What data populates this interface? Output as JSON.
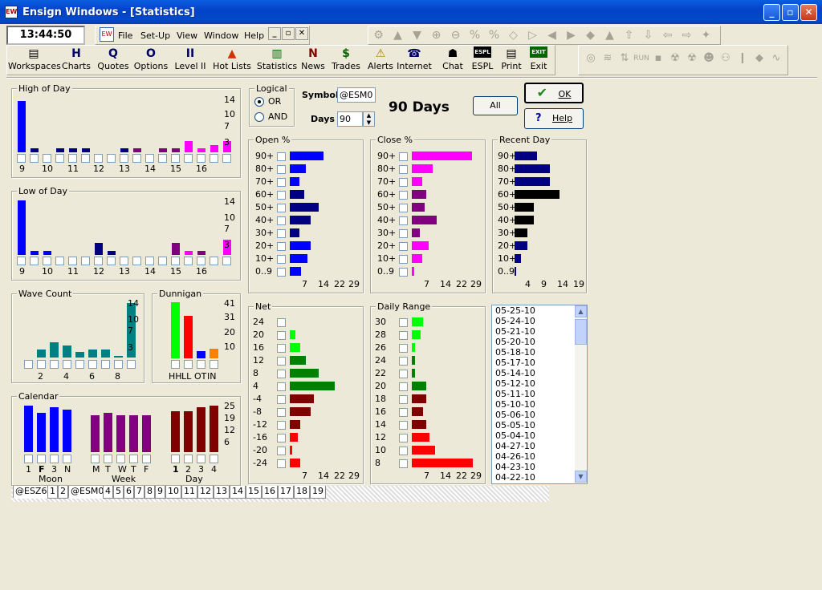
{
  "window": {
    "title": "Ensign Windows - [Statistics]",
    "minimize": "_",
    "maximize": "▫",
    "close": "✕"
  },
  "clock": "13:44:50",
  "menu": [
    "File",
    "Set-Up",
    "View",
    "Window",
    "Help"
  ],
  "toolbar": [
    "Workspaces",
    "Charts",
    "Quotes",
    "Options",
    "Level II",
    "Hot Lists",
    "Statistics",
    "News",
    "Trades",
    "Alerts",
    "Internet",
    "Chat",
    "ESPL",
    "Print",
    "Exit"
  ],
  "toolbar_glyphs": [
    "▤",
    "H",
    "Q",
    "O",
    "II",
    "▲",
    "▥",
    "N",
    "$",
    "⚠",
    "☎",
    "☗",
    "ESPL",
    "▤",
    "EXIT"
  ],
  "logical": {
    "title": "Logical",
    "or": "OR",
    "and": "AND"
  },
  "symbol": {
    "label": "Symbol",
    "value": "@ESM0"
  },
  "days": {
    "label": "Days",
    "value": "90",
    "heading": "90 Days"
  },
  "buttons": {
    "all": "All",
    "ok": "OK",
    "help": "Help"
  },
  "colors": {
    "blue": "#0000ff",
    "navy": "#000080",
    "magenta": "#ff00ff",
    "purple": "#800080",
    "teal": "#008080",
    "green": "#00ff00",
    "dkgreen": "#008000",
    "dkred": "#800000",
    "red": "#ff0000",
    "black": "#000000",
    "orange": "#ff8000"
  },
  "high_of_day": {
    "title": "High of Day",
    "y_ticks": [
      "14",
      "10",
      "7",
      "3"
    ],
    "x_labels": [
      "9",
      "10",
      "11",
      "12",
      "13",
      "14",
      "15",
      "16"
    ],
    "values": [
      14,
      1,
      0,
      1,
      1,
      1,
      0,
      0,
      1,
      1,
      0,
      1,
      1,
      3,
      1,
      2,
      3
    ],
    "colors": [
      "blue",
      "navy",
      "navy",
      "navy",
      "navy",
      "navy",
      "navy",
      "navy",
      "navy",
      "purple",
      "purple",
      "purple",
      "purple",
      "magenta",
      "magenta",
      "magenta",
      "magenta"
    ]
  },
  "low_of_day": {
    "title": "Low of Day",
    "y_ticks": [
      "14",
      "10",
      "7",
      "3"
    ],
    "x_labels": [
      "9",
      "10",
      "11",
      "12",
      "13",
      "14",
      "15",
      "16"
    ],
    "values": [
      14,
      1,
      1,
      0,
      0,
      0,
      3,
      1,
      0,
      0,
      0,
      0,
      3,
      1,
      1,
      0,
      4
    ],
    "colors": [
      "blue",
      "blue",
      "blue",
      "navy",
      "navy",
      "navy",
      "navy",
      "navy",
      "navy",
      "navy",
      "purple",
      "purple",
      "purple",
      "magenta",
      "purple",
      "magenta",
      "magenta"
    ]
  },
  "wave_count": {
    "title": "Wave Count",
    "y_ticks": [
      "14",
      "10",
      "7",
      "3"
    ],
    "x_labels": [
      "2",
      "4",
      "6",
      "8"
    ],
    "values": [
      0,
      2,
      4,
      3,
      1.5,
      2,
      2,
      0.5,
      14
    ]
  },
  "dunnigan": {
    "title": "Dunnigan",
    "y_ticks": [
      "41",
      "31",
      "20",
      "10"
    ],
    "x_labels": [
      "HH",
      "LL",
      "OT",
      "IN"
    ],
    "values": [
      41,
      31,
      5,
      7
    ],
    "colors": [
      "green",
      "red",
      "blue",
      "orange"
    ]
  },
  "calendar": {
    "title": "Calendar",
    "y_ticks": [
      "25",
      "19",
      "12",
      "6"
    ],
    "groups": [
      {
        "label": "Moon",
        "x": [
          "1",
          "F",
          "3",
          "N"
        ],
        "values": [
          25,
          21,
          24,
          23
        ]
      },
      {
        "label": "Week",
        "x": [
          "M",
          "T",
          "W",
          "T",
          "F"
        ],
        "values": [
          20,
          21,
          20,
          20,
          20
        ]
      },
      {
        "label": "Day",
        "x": [
          "1",
          "2",
          "3",
          "4"
        ],
        "values": [
          22,
          22,
          24,
          25
        ]
      }
    ]
  },
  "open_pct": {
    "title": "Open  %",
    "rows": [
      "90+",
      "80+",
      "70+",
      "60+",
      "50+",
      "40+",
      "30+",
      "20+",
      "10+",
      "0..9"
    ],
    "values": [
      21,
      10,
      6,
      9,
      18,
      13,
      6,
      13,
      11,
      7
    ],
    "colors": [
      "blue",
      "blue",
      "blue",
      "navy",
      "navy",
      "navy",
      "navy",
      "blue",
      "blue",
      "blue"
    ],
    "x_ticks": [
      "7",
      "14",
      "22",
      "29"
    ]
  },
  "close_pct": {
    "title": "Close  %",
    "rows": [
      "90+",
      "80+",
      "70+",
      "60+",
      "50+",
      "40+",
      "30+",
      "20+",
      "10+",
      "0..9"
    ],
    "values": [
      29,
      10,
      5,
      7,
      6,
      12,
      4,
      8,
      5,
      1
    ],
    "colors": [
      "magenta",
      "magenta",
      "magenta",
      "purple",
      "purple",
      "purple",
      "purple",
      "magenta",
      "magenta",
      "magenta"
    ],
    "x_ticks": [
      "7",
      "14",
      "22",
      "29"
    ]
  },
  "recent_day": {
    "title": "Recent Day",
    "rows": [
      "90+",
      "80+",
      "70+",
      "60+",
      "50+",
      "40+",
      "30+",
      "20+",
      "10+",
      "0..9"
    ],
    "values": [
      7,
      11,
      11,
      14,
      6,
      6,
      4,
      4,
      2,
      0.5
    ],
    "colors": [
      "navy",
      "navy",
      "navy",
      "black",
      "black",
      "black",
      "black",
      "navy",
      "navy",
      "navy"
    ],
    "x_ticks": [
      "4",
      "9",
      "14",
      "19"
    ]
  },
  "net": {
    "title": "Net",
    "rows": [
      "24",
      "20",
      "16",
      "12",
      "8",
      "4",
      "-4",
      "-8",
      "-12",
      "-16",
      "-20",
      "-24"
    ],
    "values": [
      0,
      2,
      4,
      6,
      11,
      17,
      9,
      8,
      4,
      3,
      1,
      4
    ],
    "colors": [
      "green",
      "green",
      "green",
      "dkgreen",
      "dkgreen",
      "dkgreen",
      "dkred",
      "dkred",
      "dkred",
      "red",
      "red",
      "red"
    ],
    "x_ticks": [
      "7",
      "14",
      "22",
      "29"
    ]
  },
  "daily_range": {
    "title": "Daily Range",
    "rows": [
      "30",
      "28",
      "26",
      "24",
      "22",
      "20",
      "18",
      "16",
      "14",
      "12",
      "10",
      "8"
    ],
    "values": [
      4,
      3,
      1,
      1,
      1,
      5,
      5,
      4,
      5,
      6,
      8,
      21
    ],
    "colors": [
      "green",
      "green",
      "green",
      "dkgreen",
      "dkgreen",
      "dkgreen",
      "dkred",
      "dkred",
      "dkred",
      "red",
      "red",
      "red"
    ],
    "x_ticks": [
      "7",
      "14",
      "22",
      "29"
    ]
  },
  "dates": [
    "05-25-10",
    "05-24-10",
    "05-21-10",
    "05-20-10",
    "05-18-10",
    "05-17-10",
    "05-14-10",
    "05-12-10",
    "05-11-10",
    "05-10-10",
    "05-06-10",
    "05-05-10",
    "05-04-10",
    "04-27-10",
    "04-26-10",
    "04-23-10",
    "04-22-10"
  ],
  "tabs": [
    "@ESZ6",
    "1",
    "2",
    "@ESM0",
    "4",
    "5",
    "6",
    "7",
    "8",
    "9",
    "10",
    "11",
    "12",
    "13",
    "14",
    "15",
    "16",
    "17",
    "18",
    "19"
  ]
}
